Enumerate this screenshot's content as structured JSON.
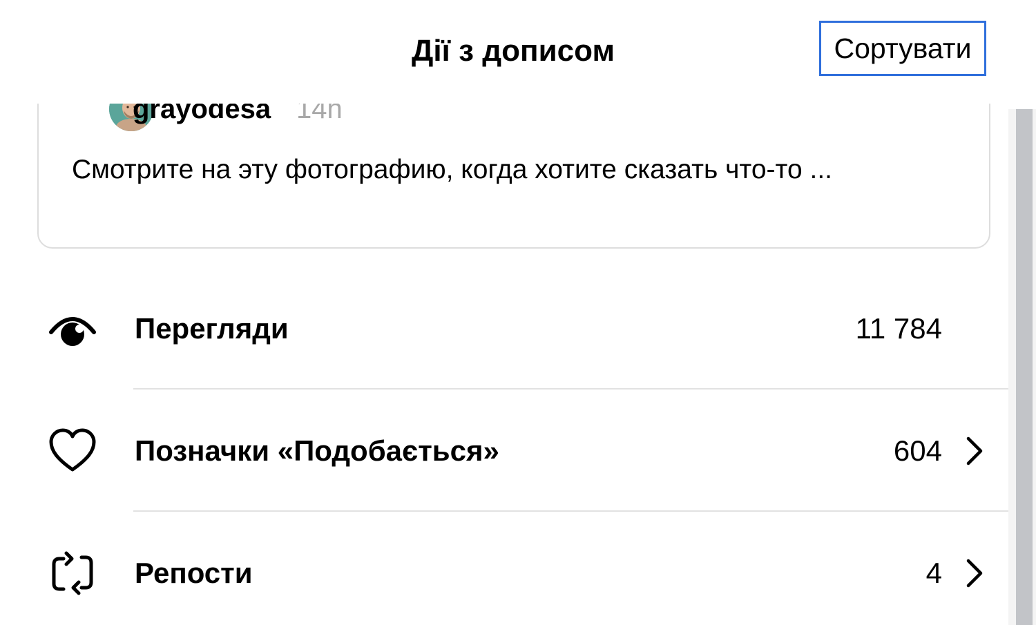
{
  "header": {
    "title": "Дії з дописом",
    "sort_label": "Сортувати"
  },
  "post": {
    "username": "grayodesa",
    "time": "14h",
    "text": "Смотрите на эту фотографию, когда хотите сказать что-то ..."
  },
  "stats": [
    {
      "label": "Перегляди",
      "value": "11 784",
      "icon": "eye-icon",
      "has_chevron": false
    },
    {
      "label": "Позначки «Подобається»",
      "value": "604",
      "icon": "heart-icon",
      "has_chevron": true
    },
    {
      "label": "Репости",
      "value": "4",
      "icon": "repost-icon",
      "has_chevron": true
    }
  ],
  "colors": {
    "accent_focus": "#2f6fdc",
    "muted_text": "#a8a8a8",
    "divider": "#e2e2e2",
    "scrollbar_thumb": "#c2c4c8"
  }
}
